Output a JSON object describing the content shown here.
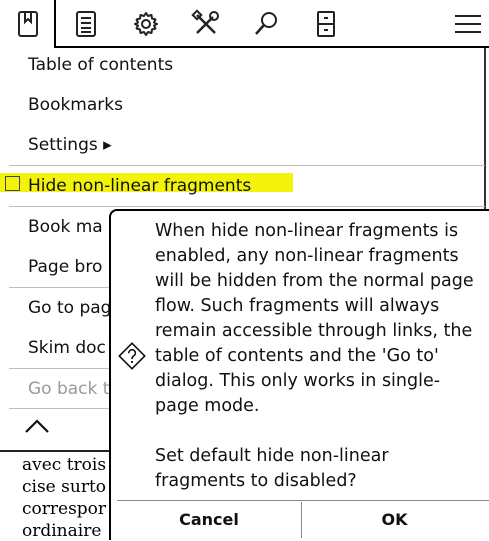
{
  "menu": {
    "items": [
      {
        "label": "Table of contents"
      },
      {
        "label": "Bookmarks"
      },
      {
        "label": "Settings ▸"
      },
      {
        "label": "Hide non-linear fragments"
      },
      {
        "label": "Book ma"
      },
      {
        "label": "Page bro"
      },
      {
        "label": "Go to pag"
      },
      {
        "label": "Skim doc"
      },
      {
        "label": "Go back t"
      }
    ]
  },
  "book_text": {
    "lines": [
      "avec trois",
      "cise surto",
      "correspor",
      "ordinaire"
    ]
  },
  "dialog": {
    "paragraph1": "When hide non-linear fragments is\nenabled, any non-linear fragments\nwill be hidden from the normal page\nflow. Such fragments will always\nremain accessible through links, the\ntable of contents and the 'Go to'\ndialog. This only works in single-\npage mode.",
    "paragraph2": "Set default hide non-linear\nfragments to disabled?",
    "cancel_label": "Cancel",
    "ok_label": "OK"
  },
  "colors": {
    "highlight": "#f3f20a"
  }
}
